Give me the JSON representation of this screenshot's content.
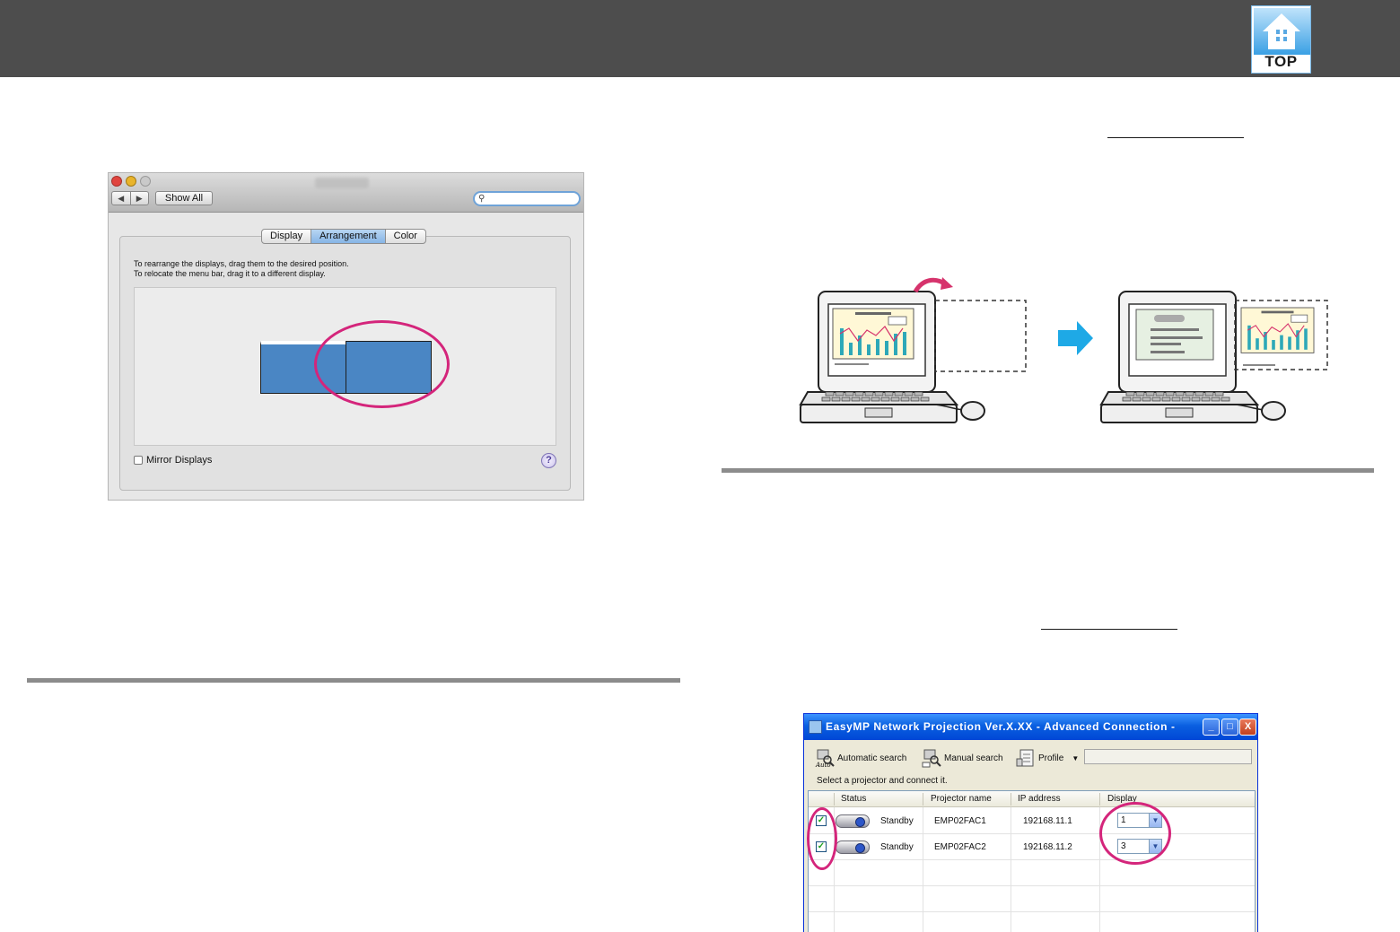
{
  "header": {
    "logo": {
      "text": "TOP",
      "icon": "home-icon"
    }
  },
  "mac_dialog": {
    "nav": {
      "back": "◀",
      "forward": "▶"
    },
    "show_all": "Show All",
    "search_placeholder": "",
    "tabs": [
      "Display",
      "Arrangement",
      "Color"
    ],
    "active_tab": "Arrangement",
    "instructions": [
      "To rearrange the displays, drag them to the desired position.",
      "To relocate the menu bar, drag it to a different display."
    ],
    "mirror_displays": {
      "label": "Mirror Displays",
      "checked": false
    },
    "help": "?"
  },
  "win_dialog": {
    "title": "EasyMP Network Projection Ver.X.XX - Advanced Connection -",
    "controls": {
      "minimize": "_",
      "maximize": "□",
      "close": "X"
    },
    "toolbar": {
      "automatic_search": "Automatic search",
      "manual_search": "Manual search",
      "profile": "Profile"
    },
    "select_label": "Select a projector and connect it.",
    "columns": [
      "Status",
      "Projector name",
      "IP address",
      "Display"
    ],
    "rows": [
      {
        "checked": true,
        "status": "Standby",
        "name": "EMP02FAC1",
        "ip": "192168.11.1",
        "display": "1"
      },
      {
        "checked": true,
        "status": "Standby",
        "name": "EMP02FAC2",
        "ip": "192168.11.2",
        "display": "3"
      }
    ]
  },
  "colors": {
    "header_band": "#4d4d4d",
    "highlight_circle": "#d4257b",
    "display_blue": "#4a86c4",
    "arrow_cyan": "#1ea9e6"
  }
}
